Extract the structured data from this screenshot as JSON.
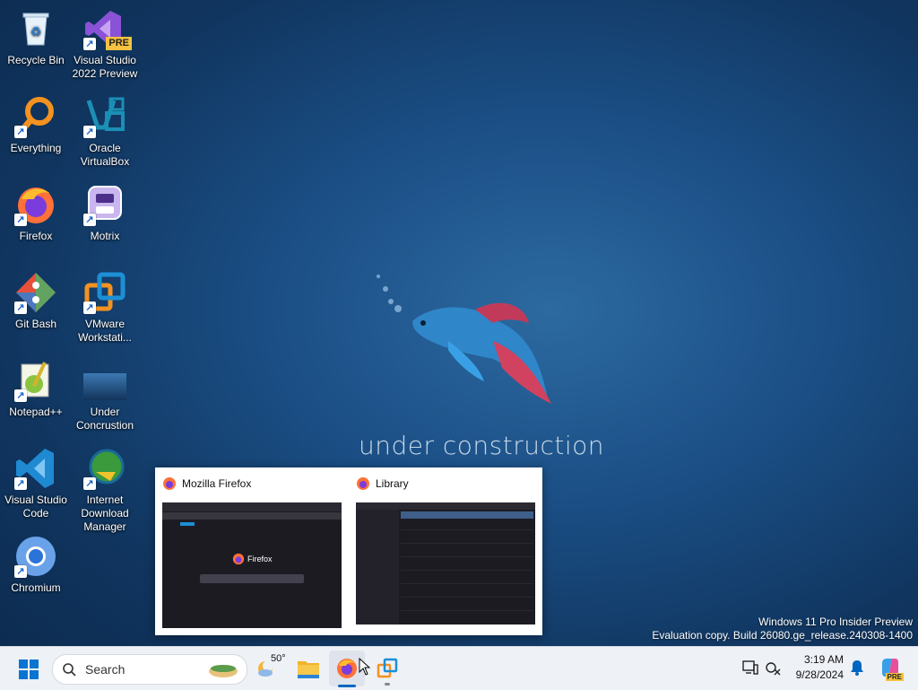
{
  "desktop": {
    "icons": [
      {
        "label": "Recycle Bin",
        "icon": "recycle-bin-icon"
      },
      {
        "label": "Visual Studio 2022 Preview",
        "icon": "visual-studio-preview-icon",
        "badge": "PRE"
      },
      {
        "label": "Everything",
        "icon": "everything-search-icon"
      },
      {
        "label": "Oracle VirtualBox",
        "icon": "virtualbox-icon"
      },
      {
        "label": "Firefox",
        "icon": "firefox-icon"
      },
      {
        "label": "Motrix",
        "icon": "motrix-icon"
      },
      {
        "label": "Git Bash",
        "icon": "git-bash-icon"
      },
      {
        "label": "VMware Workstati...",
        "icon": "vmware-icon"
      },
      {
        "label": "Notepad++",
        "icon": "notepadpp-icon"
      },
      {
        "label": "Under Concrustion",
        "icon": "folder-image-icon"
      },
      {
        "label": "Visual Studio Code",
        "icon": "vscode-icon"
      },
      {
        "label": "Internet Download Manager",
        "icon": "idm-icon"
      },
      {
        "label": "Chromium",
        "icon": "chromium-icon"
      }
    ],
    "wallpaper_text": "under construction",
    "watermark_line1": "Windows 11 Pro Insider Preview",
    "watermark_line2": "Evaluation copy. Build 26080.ge_release.240308-1400"
  },
  "preview": {
    "windows": [
      {
        "title": "Mozilla Firefox",
        "brand": "Firefox"
      },
      {
        "title": "Library"
      }
    ]
  },
  "taskbar": {
    "search_placeholder": "Search",
    "weather_temp": "50°",
    "time": "3:19 AM",
    "date": "9/28/2024",
    "copilot_badge": "PRE"
  },
  "colors": {
    "accent": "#0067c0",
    "taskbar_bg": "#eef1f6"
  }
}
